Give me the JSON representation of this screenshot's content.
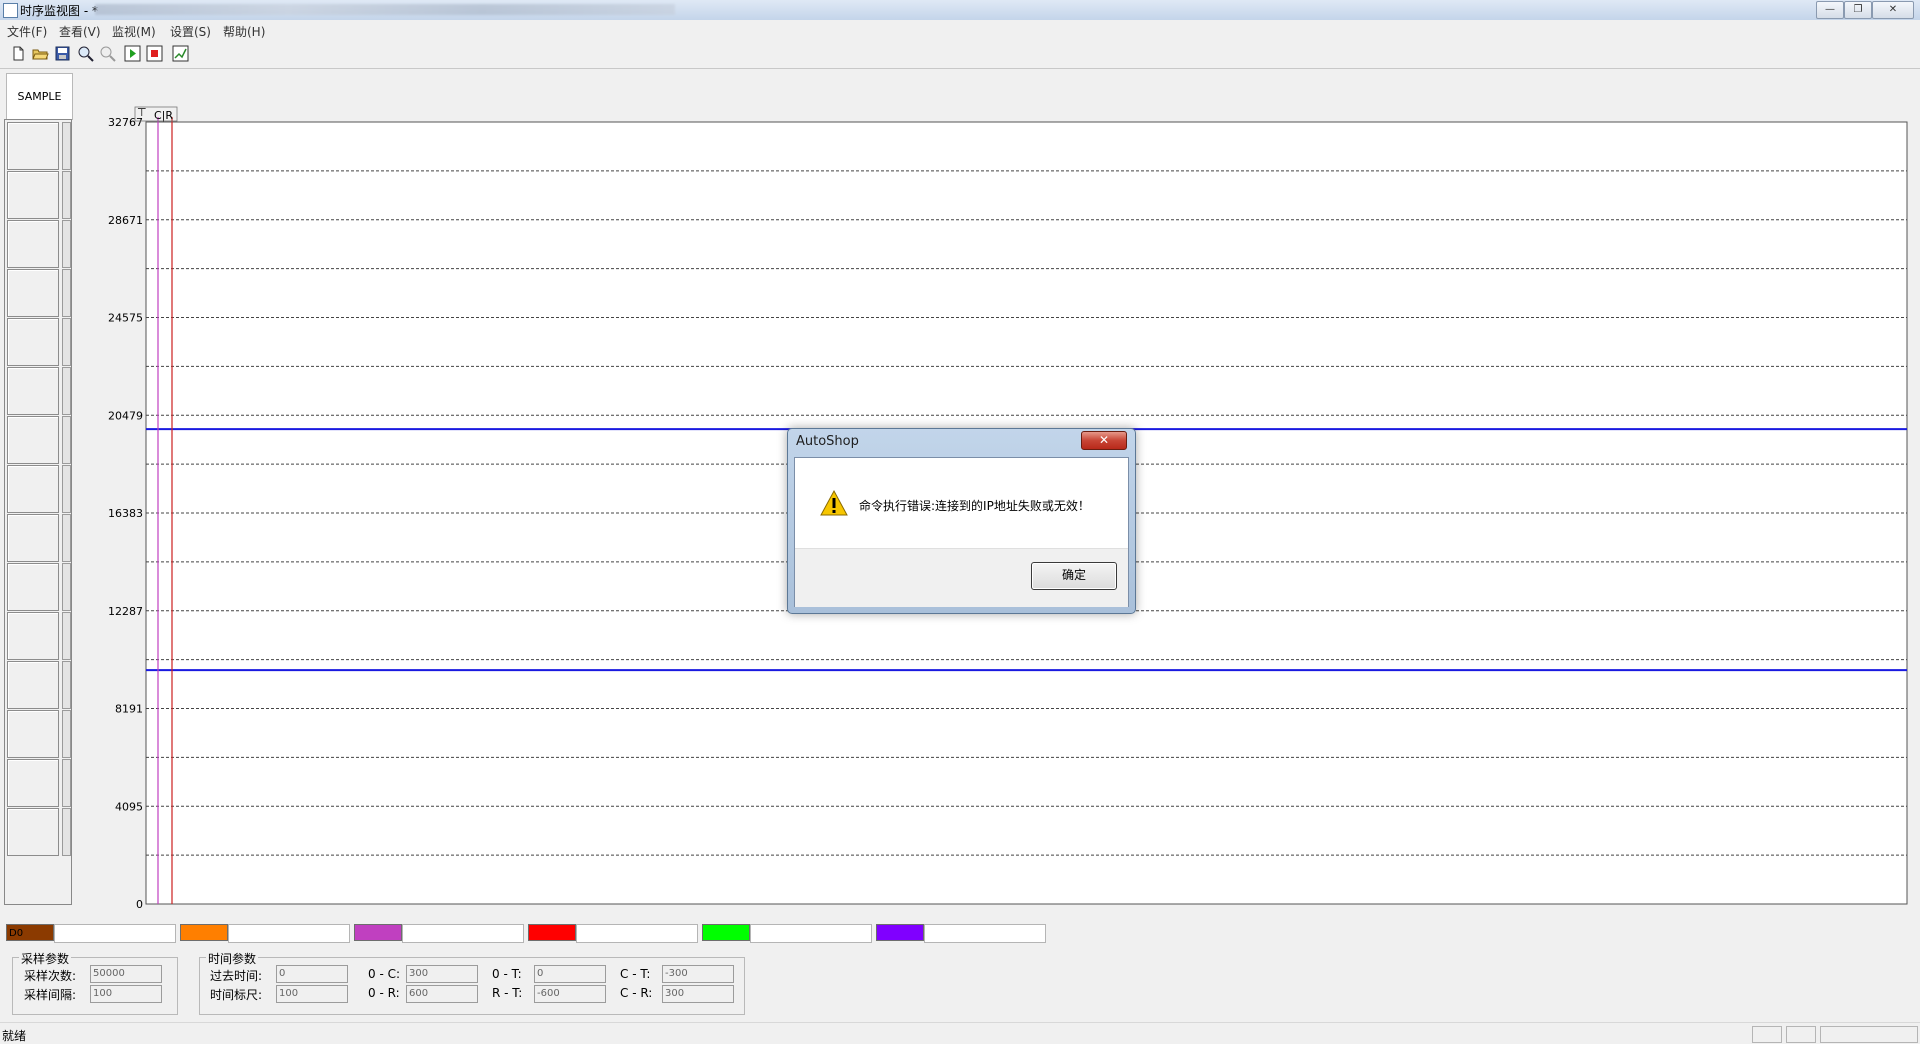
{
  "window": {
    "title": "时序监视图 - *",
    "title_path_obscured": true
  },
  "menu": {
    "items": [
      "文件(F)",
      "查看(V)",
      "监视(M)",
      "设置(S)",
      "帮助(H)"
    ]
  },
  "toolbar": {
    "icons": [
      "new-icon",
      "open-icon",
      "save-icon",
      "zoom-in-icon",
      "zoom-out-icon",
      "start-icon",
      "stop-icon",
      "settings-icon"
    ]
  },
  "left_panel": {
    "tab_label": "SAMPLE",
    "cell_count": 15
  },
  "chart": {
    "cursor_label": "C|R",
    "filter_glyph": "⊤"
  },
  "chart_data": {
    "type": "line",
    "yticks": [
      "32767",
      "28671",
      "24575",
      "20479",
      "16383",
      "12287",
      "8191",
      "4095",
      "0"
    ],
    "ylim": [
      0,
      32767
    ],
    "grid": true,
    "horizontal_lines": [
      19900,
      9800
    ],
    "cursors": [
      {
        "name": "C",
        "color": "#c040c0"
      },
      {
        "name": "R",
        "color": "#cc2020"
      }
    ]
  },
  "dialog": {
    "title": "AutoShop",
    "close_label": "✕",
    "message": "命令执行错误:连接到的IP地址失败或无效！",
    "ok_label": "确定"
  },
  "legend": {
    "channels": [
      {
        "label": "D0",
        "color": "#8b3a00"
      },
      {
        "label": "",
        "color": "#ff7f00"
      },
      {
        "label": "",
        "color": "#c040c0"
      },
      {
        "label": "",
        "color": "#ff0000"
      },
      {
        "label": "",
        "color": "#00ff00"
      },
      {
        "label": "",
        "color": "#8000ff"
      }
    ]
  },
  "sampling": {
    "title": "采样参数",
    "count_label": "采样次数:",
    "count_value": "50000",
    "interval_label": "采样间隔:",
    "interval_value": "100"
  },
  "time": {
    "title": "时间参数",
    "elapsed_label": "过去时间:",
    "elapsed_value": "0",
    "scale_label": "时间标尺:",
    "scale_value": "100",
    "oc_label": "0 - C:",
    "oc_value": "300",
    "or_label": "0 - R:",
    "or_value": "600",
    "ot_label": "0 - T:",
    "ot_value": "0",
    "rt_label": "R - T:",
    "rt_value": "-600",
    "ct_label": "C - T:",
    "ct_value": "-300",
    "cr_label": "C - R:",
    "cr_value": "300"
  },
  "status": {
    "text": "就绪"
  }
}
